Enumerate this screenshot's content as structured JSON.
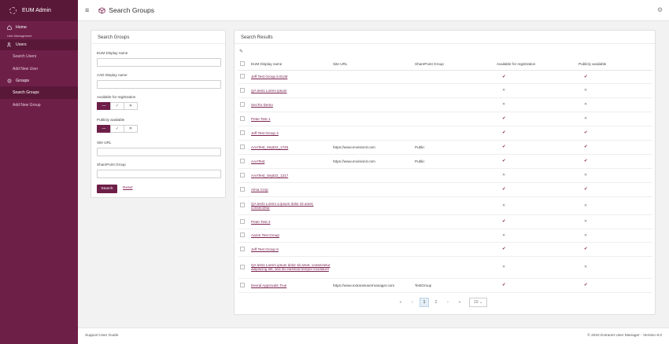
{
  "app": {
    "title": "EUM Admin"
  },
  "sidebar": {
    "home": "Home",
    "section_caption": "User Management",
    "users": "Users",
    "users_items": [
      "Search Users",
      "Add New User"
    ],
    "groups": "Groups",
    "groups_items": [
      "Search Groups",
      "Add New Group"
    ]
  },
  "header": {
    "title": "Search Groups"
  },
  "search": {
    "title": "Search Groups",
    "fields": {
      "eum_name": "EUM Display name",
      "aad_name": "AAD Display name",
      "available": "Available for registration",
      "public": "Publicly available",
      "site_url": "Site URL",
      "sp_group": "SharePoint Group"
    },
    "tri": [
      "—",
      "✓",
      "✕"
    ],
    "search_btn": "Search",
    "reset_btn": "Reset"
  },
  "results": {
    "title": "Search Results",
    "columns": [
      "EUM Display name",
      "Site URL",
      "SharePoint Group",
      "Available for registration",
      "Publicly available"
    ],
    "rows": [
      {
        "name": "Jeff Test Group 5 EUM",
        "url": "",
        "sp": "",
        "avail": true,
        "pub": true
      },
      {
        "name": "QA test1 Lorem ipsum",
        "url": "",
        "sp": "",
        "avail": false,
        "pub": false
      },
      {
        "name": "SecTor Demo",
        "url": "",
        "sp": "",
        "avail": false,
        "pub": false
      },
      {
        "name": "Peter Test 1",
        "url": "",
        "sp": "",
        "avail": true,
        "pub": false
      },
      {
        "name": "Jeff Test Group 4",
        "url": "",
        "sp": "",
        "avail": true,
        "pub": true
      },
      {
        "name": "AAATest_Sept22_1745",
        "url": "https://www.envisionit.com",
        "sp": "Public",
        "avail": true,
        "pub": true
      },
      {
        "name": "AAATest",
        "url": "https://www.envisionit.com",
        "sp": "Public",
        "avail": true,
        "pub": true
      },
      {
        "name": "AAATest_Sept22_1317",
        "url": "",
        "sp": "",
        "avail": false,
        "pub": false
      },
      {
        "name": "Alma Corp",
        "url": "",
        "sp": "",
        "avail": true,
        "pub": true
      },
      {
        "name": "QA test1 Lorem a ipsum dolor sit amet, consectetur",
        "url": "",
        "sp": "",
        "avail": false,
        "pub": false
      },
      {
        "name": "Peter Test 2",
        "url": "",
        "sp": "",
        "avail": true,
        "pub": false
      },
      {
        "name": "Aaron Test Group",
        "url": "",
        "sp": "",
        "avail": false,
        "pub": false
      },
      {
        "name": "Jeff Test Group 6",
        "url": "",
        "sp": "",
        "avail": true,
        "pub": true
      },
      {
        "name": "QA test1 Lorem ipsum dolor sit amet, consectetur adipiscing elit, sed do eiusmod tempor incididunt",
        "url": "",
        "sp": "",
        "avail": false,
        "pub": false
      },
      {
        "name": "Devral Approvals True",
        "url": "https://www.extranetusermanager.com",
        "sp": "TestGroup",
        "avail": true,
        "pub": true
      }
    ]
  },
  "pager": {
    "first": "«",
    "prev": "‹",
    "pages": [
      "1",
      "2"
    ],
    "next": "›",
    "last": "»",
    "page_size": "10"
  },
  "footer": {
    "left": "Support  User Guide",
    "right": "© 2022 Extranet User Manager - Version 8.0"
  },
  "colors": {
    "brand": "#6e1f48",
    "brand_dark": "#5a1838"
  }
}
